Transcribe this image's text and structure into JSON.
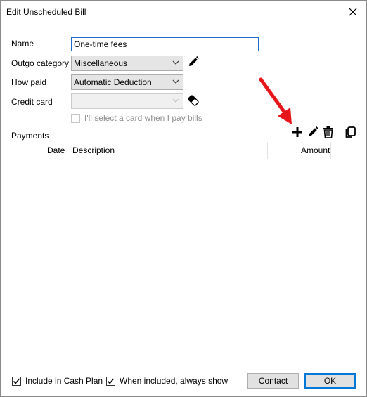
{
  "window": {
    "title": "Edit Unscheduled Bill"
  },
  "form": {
    "name_label": "Name",
    "name_value": "One-time fees",
    "outgo_label": "Outgo category",
    "outgo_value": "Miscellaneous",
    "howpaid_label": "How paid",
    "howpaid_value": "Automatic Deduction",
    "creditcard_label": "Credit card",
    "creditcard_value": "",
    "select_card_label": "I'll select a card when I pay bills",
    "select_card_checked": false
  },
  "payments": {
    "label": "Payments",
    "columns": [
      "Date",
      "Description",
      "Amount"
    ],
    "rows": []
  },
  "footer": {
    "include_cash_plan_label": "Include in Cash Plan",
    "include_cash_plan_checked": true,
    "always_show_label": "When included, always show",
    "always_show_checked": true,
    "contact_label": "Contact",
    "ok_label": "OK"
  },
  "icons": {
    "close": "close-icon",
    "edit_category": "pencil-icon",
    "eraser": "eraser-icon",
    "add": "plus-icon",
    "edit": "pencil-icon",
    "delete": "trash-icon",
    "copy": "copy-icon",
    "annotation_arrow": "red-arrow-icon"
  },
  "colors": {
    "accent": "#0078d7",
    "annotation": "#e8151b"
  }
}
